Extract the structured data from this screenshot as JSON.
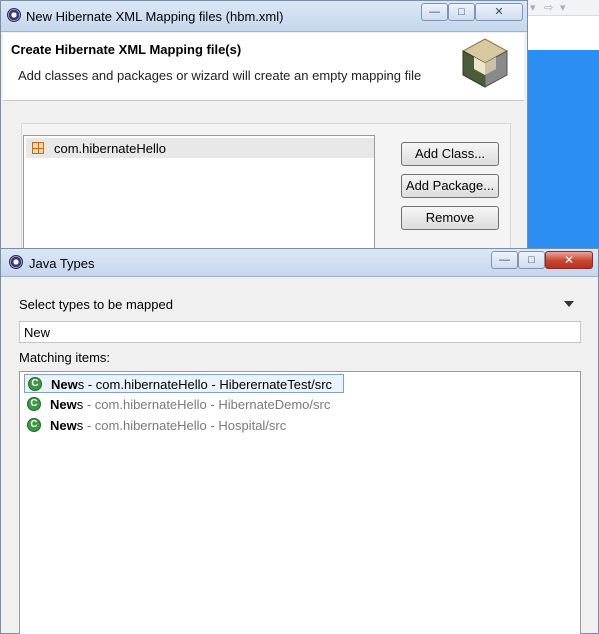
{
  "hibernate_dialog": {
    "title": "New Hibernate XML Mapping files (hbm.xml)",
    "header_title": "Create Hibernate XML Mapping file(s)",
    "header_description": "Add classes and packages or wizard will create an empty mapping file",
    "list_items": [
      {
        "label": "com.hibernateHello",
        "icon": "package-icon"
      }
    ],
    "buttons": {
      "add_class": "Add Class...",
      "add_package": "Add Package...",
      "remove": "Remove"
    },
    "window_controls": {
      "minimize": "—",
      "maximize": "□",
      "close": "✕"
    }
  },
  "java_types_dialog": {
    "title": "Java Types",
    "select_label": "Select types to be mapped",
    "filter_value": "New",
    "matching_label": "Matching items:",
    "window_controls": {
      "minimize": "—",
      "maximize": "□",
      "close": "✕"
    },
    "items": [
      {
        "match": "New",
        "rest": "s",
        "qualifier": " - com.hibernateHello - HiberernateTest/src",
        "selected": true,
        "icon": "class-icon"
      },
      {
        "match": "New",
        "rest": "s",
        "qualifier": " - com.hibernateHello - HibernateDemo/src",
        "selected": false,
        "icon": "class-icon"
      },
      {
        "match": "New",
        "rest": "s",
        "qualifier": " - com.hibernateHello - Hospital/src",
        "selected": false,
        "icon": "class-icon"
      }
    ]
  },
  "colors": {
    "selection_bg": "#eaf2fb",
    "selection_border": "#7da2ce",
    "class_icon": "#3a9a44",
    "background_ide": "#2a8ef2"
  }
}
